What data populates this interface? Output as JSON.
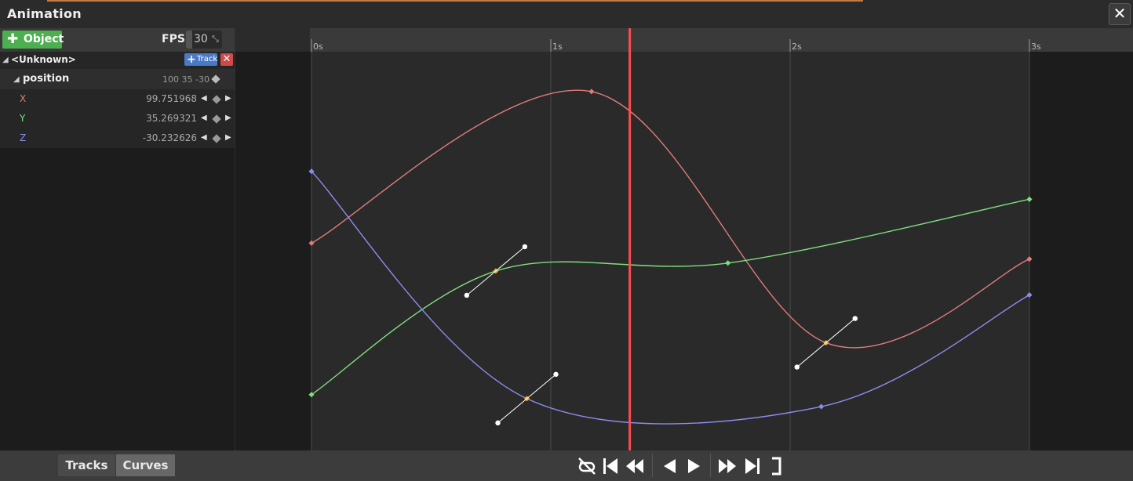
{
  "window": {
    "title": "Animation",
    "close_icon": "close-icon"
  },
  "toolbar": {
    "object_button": "Object",
    "fps_label": "FPS",
    "fps_value": "30"
  },
  "tree": {
    "object": {
      "label": "<Unknown>",
      "add_track_button": "Track"
    },
    "track": {
      "label": "position",
      "values": "100  35  -30"
    },
    "axes": [
      {
        "name": "X",
        "value": "99.751968",
        "color": "#e07b7b"
      },
      {
        "name": "Y",
        "value": "35.269321",
        "color": "#7de07d"
      },
      {
        "name": "Z",
        "value": "-30.232626",
        "color": "#8c8cf0"
      }
    ]
  },
  "timeline": {
    "ticks": [
      "0s",
      "1s",
      "2s",
      "3s"
    ],
    "playhead_time": 1.33,
    "playhead_color": "#ff4d4d"
  },
  "chart_data": {
    "type": "line",
    "x_unit": "s",
    "xlim": [
      0,
      3
    ],
    "series": [
      {
        "name": "X",
        "color": "#e07b7b",
        "keyframes": [
          {
            "t": 0,
            "v": 0.52
          },
          {
            "t": 1.17,
            "v": 0.9
          },
          {
            "t": 2.15,
            "v": 0.27
          },
          {
            "t": 3.0,
            "v": 0.48
          }
        ]
      },
      {
        "name": "Y",
        "color": "#7de07d",
        "keyframes": [
          {
            "t": 0,
            "v": 0.14
          },
          {
            "t": 0.77,
            "v": 0.45
          },
          {
            "t": 1.74,
            "v": 0.47
          },
          {
            "t": 3.0,
            "v": 0.63
          }
        ]
      },
      {
        "name": "Z",
        "color": "#8c8cf0",
        "keyframes": [
          {
            "t": 0,
            "v": 0.7
          },
          {
            "t": 0.9,
            "v": 0.13
          },
          {
            "t": 2.13,
            "v": 0.11
          },
          {
            "t": 3.0,
            "v": 0.39
          }
        ]
      }
    ],
    "selected_keyframe_color": "#f0b030",
    "tangent_handle_color": "#ffffff"
  },
  "bottom": {
    "tabs": [
      "Tracks",
      "Curves"
    ],
    "active_tab": "Curves",
    "transport_icons": [
      "loop-off-icon",
      "jump-to-start-icon",
      "prev-key-icon",
      "play-backward-icon",
      "play-forward-icon",
      "next-key-icon",
      "jump-to-end-icon",
      "range-end-icon"
    ]
  }
}
